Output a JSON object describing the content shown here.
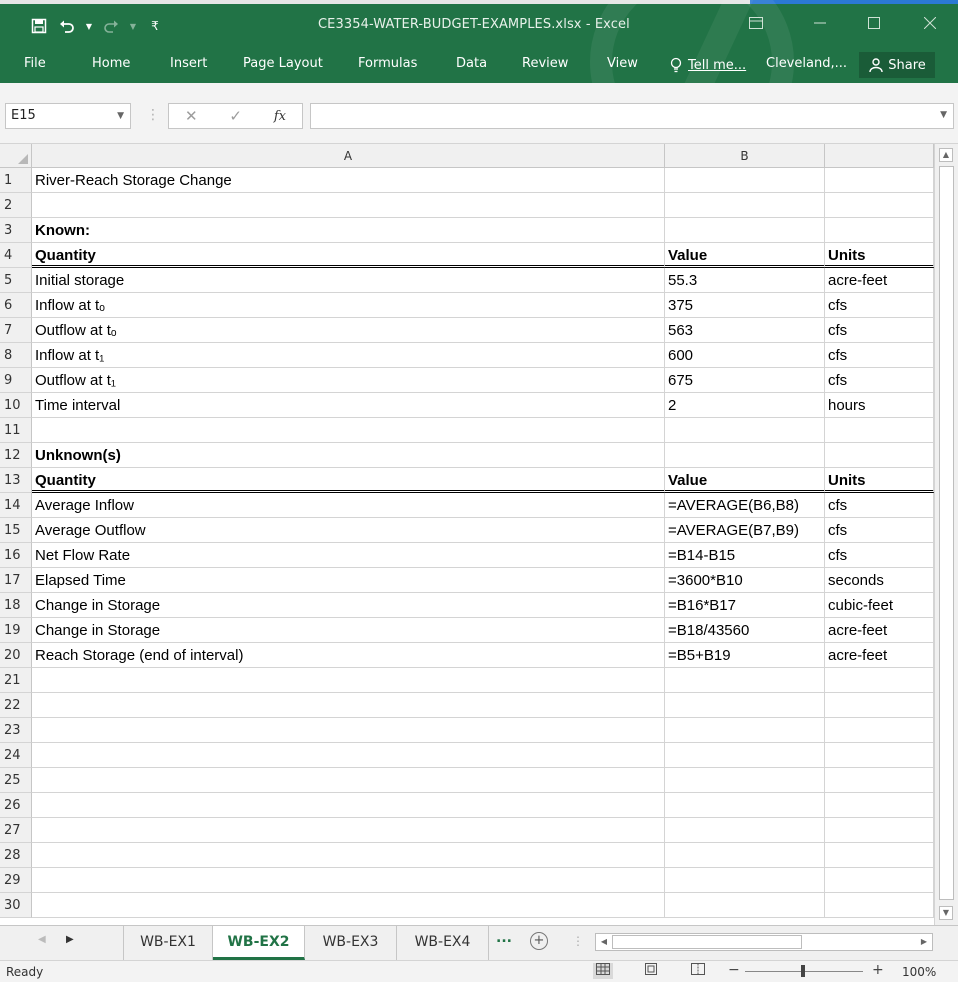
{
  "app": {
    "window_title": "CE3354-WATER-BUDGET-EXAMPLES.xlsx - Excel",
    "user": "Cleveland,...",
    "share_label": "Share",
    "tell_me": "Tell me..."
  },
  "ribbon": {
    "tabs": [
      "File",
      "Home",
      "Insert",
      "Page Layout",
      "Formulas",
      "Data",
      "Review",
      "View"
    ]
  },
  "formula_bar": {
    "name_box": "E15",
    "formula": ""
  },
  "columns": [
    "A",
    "B"
  ],
  "rows": [
    {
      "n": "1",
      "a": "River-Reach Storage Change",
      "b": "",
      "c": ""
    },
    {
      "n": "2",
      "a": "",
      "b": "",
      "c": ""
    },
    {
      "n": "3",
      "a": "Known:",
      "b": "",
      "c": ""
    },
    {
      "n": "4",
      "a": "Quantity",
      "b": "Value",
      "c": "Units"
    },
    {
      "n": "5",
      "a": "Initial storage",
      "b": "55.3",
      "c": "acre-feet"
    },
    {
      "n": "6",
      "a": "Inflow at tₒ",
      "b": "375",
      "c": "cfs"
    },
    {
      "n": "7",
      "a": "Outflow at tₒ",
      "b": "563",
      "c": "cfs"
    },
    {
      "n": "8",
      "a": "Inflow at t₁",
      "b": "600",
      "c": "cfs"
    },
    {
      "n": "9",
      "a": "Outflow at t₁",
      "b": "675",
      "c": "cfs"
    },
    {
      "n": "10",
      "a": "Time interval",
      "b": "2",
      "c": "hours"
    },
    {
      "n": "11",
      "a": "",
      "b": "",
      "c": ""
    },
    {
      "n": "12",
      "a": "Unknown(s)",
      "b": "",
      "c": ""
    },
    {
      "n": "13",
      "a": "Quantity",
      "b": "Value",
      "c": "Units"
    },
    {
      "n": "14",
      "a": "Average Inflow",
      "b": "=AVERAGE(B6,B8)",
      "c": "cfs"
    },
    {
      "n": "15",
      "a": "Average Outflow",
      "b": "=AVERAGE(B7,B9)",
      "c": "cfs"
    },
    {
      "n": "16",
      "a": "Net Flow Rate",
      "b": "=B14-B15",
      "c": "cfs"
    },
    {
      "n": "17",
      "a": "Elapsed Time",
      "b": "=3600*B10",
      "c": "seconds"
    },
    {
      "n": "18",
      "a": "Change in Storage",
      "b": "=B16*B17",
      "c": "cubic-feet"
    },
    {
      "n": "19",
      "a": "Change in Storage",
      "b": "=B18/43560",
      "c": "acre-feet"
    },
    {
      "n": "20",
      "a": "Reach Storage (end of interval)",
      "b": "=B5+B19",
      "c": "acre-feet"
    },
    {
      "n": "21",
      "a": "",
      "b": "",
      "c": ""
    },
    {
      "n": "22",
      "a": "",
      "b": "",
      "c": ""
    },
    {
      "n": "23",
      "a": "",
      "b": "",
      "c": ""
    },
    {
      "n": "24",
      "a": "",
      "b": "",
      "c": ""
    },
    {
      "n": "25",
      "a": "",
      "b": "",
      "c": ""
    },
    {
      "n": "26",
      "a": "",
      "b": "",
      "c": ""
    },
    {
      "n": "27",
      "a": "",
      "b": "",
      "c": ""
    },
    {
      "n": "28",
      "a": "",
      "b": "",
      "c": ""
    },
    {
      "n": "29",
      "a": "",
      "b": "",
      "c": ""
    },
    {
      "n": "30",
      "a": "",
      "b": "",
      "c": ""
    }
  ],
  "sheet_tabs": [
    "WB-EX1",
    "WB-EX2",
    "WB-EX3",
    "WB-EX4"
  ],
  "active_sheet": "WB-EX2",
  "more_sheets": "...",
  "status": {
    "text": "Ready",
    "zoom": "100%"
  },
  "colors": {
    "excel_green": "#217346"
  }
}
